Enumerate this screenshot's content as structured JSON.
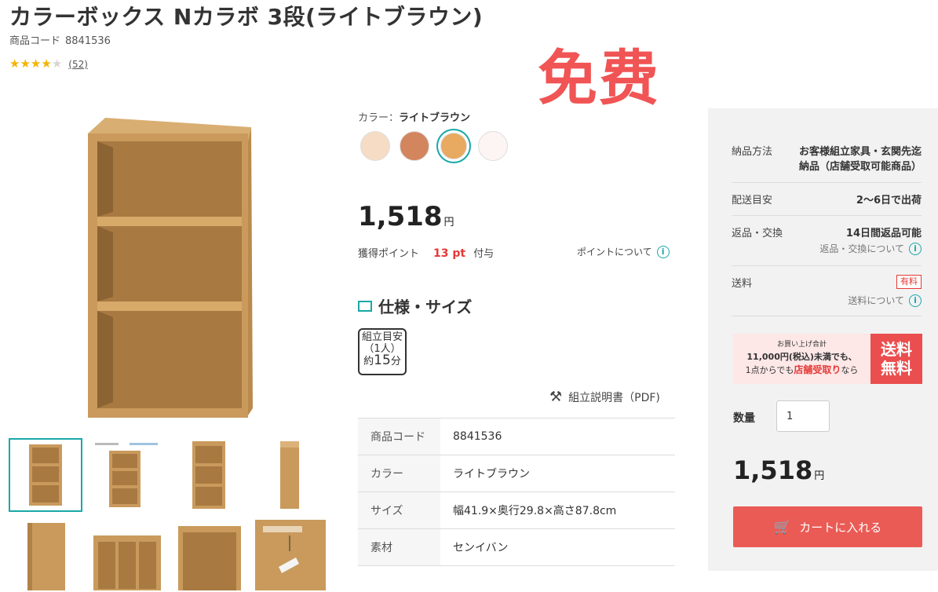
{
  "product": {
    "title": "カラーボックス Nカラボ 3段(ライトブラウン)",
    "code_label": "商品コード",
    "code": "8841536",
    "rating": 4,
    "review_count": "(52)"
  },
  "overlay_text": "免费",
  "color": {
    "label": "カラー：",
    "selected": "ライトブラウン",
    "swatches": [
      "#f7dcc5",
      "#d3855e",
      "#e8a961",
      "#fdf5f3"
    ],
    "selected_index": 2
  },
  "price": {
    "value": "1,518",
    "unit": "円"
  },
  "points": {
    "label": "獲得ポイント",
    "value": "13 pt",
    "suffix": "付与",
    "link": "ポイントについて"
  },
  "spec": {
    "heading": "仕様・サイズ",
    "assembly_badge": {
      "line1": "組立目安",
      "line2": "（1人）",
      "line3a": "約",
      "line3b": "15",
      "line3c": "分"
    },
    "manual_link": "組立説明書（PDF)",
    "rows": [
      {
        "key": "商品コード",
        "value": "8841536"
      },
      {
        "key": "カラー",
        "value": "ライトブラウン"
      },
      {
        "key": "サイズ",
        "value": "幅41.9×奥行29.8×高さ87.8cm"
      },
      {
        "key": "素材",
        "value": "センイバン"
      }
    ]
  },
  "delivery": {
    "method_label": "納品方法",
    "method_value_1": "お客様組立家具・玄関先迄",
    "method_value_2": "納品（店舗受取可能商品）",
    "eta_label": "配送目安",
    "eta_value": "2〜6日で出荷",
    "return_label": "返品・交換",
    "return_value": "14日間返品可能",
    "return_link": "返品・交換について",
    "shipping_label": "送料",
    "shipping_badge": "有料",
    "shipping_link": "送料について"
  },
  "banner": {
    "line1": "お買い上げ合計",
    "line2": "11,000円(税込)未満でも、",
    "line3a": "1点からでも",
    "line3b": "店舗受取り",
    "line3c": "なら",
    "red_line1": "送料",
    "red_line2": "無料"
  },
  "quantity": {
    "label": "数量",
    "value": "1"
  },
  "price2": {
    "value": "1,518",
    "unit": "円"
  },
  "cart_button": "カートに入れる",
  "colors": {
    "accent": "#1aa8a8",
    "red": "#e53935",
    "cart": "#ea5b55",
    "wood": "#c99a5c"
  }
}
